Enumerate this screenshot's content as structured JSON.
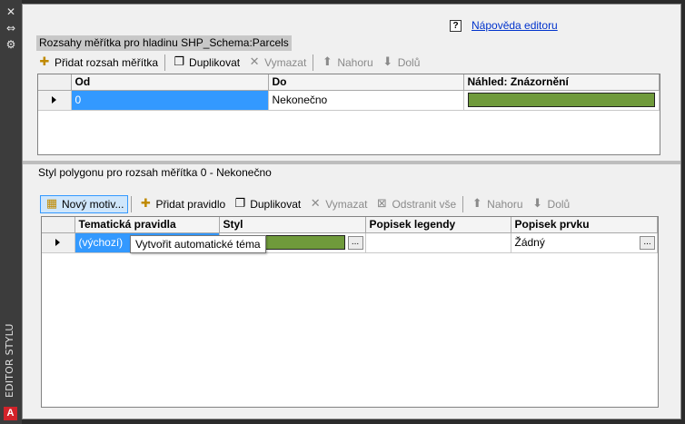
{
  "sidebar": {
    "close_glyph": "✕",
    "dock_glyph": "⇔",
    "settings_glyph": "⚙",
    "title": "EDITOR STYLU",
    "logo": "A"
  },
  "help": {
    "icon": "?",
    "link": "Nápověda editoru"
  },
  "scale_ranges": {
    "title": "Rozsahy měřítka pro hladinu SHP_Schema:Parcels",
    "toolbar": {
      "add": "Přidat rozsah měřítka",
      "duplicate": "Duplikovat",
      "delete": "Vymazat",
      "up": "Nahoru",
      "down": "Dolů"
    },
    "columns": [
      "Od",
      "Do",
      "Náhled: Znázornění"
    ],
    "rows": [
      {
        "from": "0",
        "to": "Nekonečno",
        "preview_color": "#6f9a3b"
      }
    ]
  },
  "polygon_style": {
    "title": "Styl polygonu pro rozsah měřítka 0 - Nekonečno",
    "toolbar": {
      "new_theme": "Nový motiv...",
      "add_rule": "Přidat pravidlo",
      "duplicate": "Duplikovat",
      "delete": "Vymazat",
      "remove_all": "Odstranit vše",
      "up": "Nahoru",
      "down": "Dolů"
    },
    "columns": [
      "Tematická pravidla",
      "Styl",
      "Popisek legendy",
      "Popisek prvku"
    ],
    "rows": [
      {
        "rule": "(výchozí)",
        "style_color": "#6f9a3b",
        "legend": "",
        "feature_label": "Žádný",
        "dots": "..."
      }
    ]
  },
  "tooltip": "Vytvořit automatické téma",
  "colors": {
    "selection": "#3399ff",
    "fill": "#6f9a3b",
    "link": "#0033cc"
  }
}
